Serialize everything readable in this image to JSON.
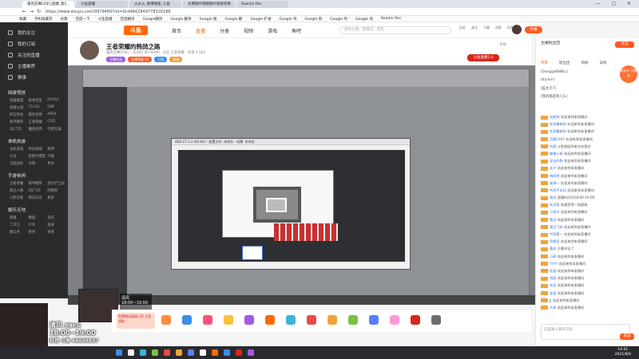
{
  "browser": {
    "tabs": [
      {
        "label": "蓬风恋赛CDEC直播_第5...",
        "active": true
      },
      {
        "label": "斗鱼直播",
        "active": false
      },
      {
        "label": "火炎火_微博搜索_斗鱼",
        "active": false
      },
      {
        "label": "文库图片网络图片搜索结果",
        "active": false
      },
      {
        "label": "Rwxdin Rec",
        "active": false
      }
    ],
    "window_controls": "— ▢ ✕",
    "url": "https://www.douyu.com/9979489?rid=0cd4662849778320188",
    "bookmarks": [
      "收藏",
      "手机收藏夹",
      "谷歌",
      "百度一下",
      "斗鱼直播",
      "百度翻译",
      "Google翻译",
      "Google 翻译",
      "Google 搜",
      "Google 翻",
      "Google 扩展",
      "Google 书",
      "Google 新",
      "Google 导",
      "Google 地",
      "Reader Rec"
    ]
  },
  "sidebar": {
    "top_items": [
      "我的关注",
      "我的订阅",
      "关注的直播",
      "主播推荐",
      "赛事"
    ],
    "sections": [
      {
        "title": "网游竞技",
        "items": [
          "英雄联盟",
          "绝地求生",
          "DOTA2",
          "穿越火线",
          "CS:GO",
          "DNF",
          "炉石传说",
          "我的世界",
          "APEX",
          "和平精英",
          "王者荣耀",
          "COD",
          "QQ飞车",
          "魔兽世界",
          "守望先锋"
        ]
      },
      {
        "title": "单机热游",
        "items": [
          "主机游戏",
          "怀旧游戏",
          "原神",
          "方舟",
          "荒野大镖客",
          "只狼",
          "全面战争",
          "文明",
          "更多"
        ]
      },
      {
        "title": "手游休闲",
        "items": [
          "王者荣耀",
          "和平精英",
          "金铲铲之战",
          "第五人格",
          "QQ飞车",
          "阴阳师",
          "火影忍者",
          "明日方舟",
          "更多"
        ]
      },
      {
        "title": "娱乐天地",
        "items": [
          "颜值",
          "舞蹈",
          "音乐",
          "二次元",
          "户外",
          "美食",
          "脱口秀",
          "星秀",
          "体育"
        ]
      }
    ]
  },
  "site_header": {
    "logo": "斗鱼",
    "nav": [
      "首页",
      "直播",
      "分类",
      "视频",
      "游戏",
      "鱼吧"
    ],
    "search_placeholder": "搜索主播、直播间、游戏",
    "icons": [
      "历史",
      "关注",
      "下载",
      "消息",
      "任务"
    ],
    "open_broadcast": "开播"
  },
  "streamer": {
    "title": "王者荣耀的韩鸽之路",
    "meta": "蓬风恋赛CDEC · 房间号 9979489 · 分区 王者荣耀 · 热度 4,562",
    "pills": [
      "主播任务",
      "主播等级 42",
      "订阅",
      "周星"
    ],
    "report": "举报",
    "badge": "斗鱼直播2.0"
  },
  "nested": {
    "inner_tab": "蓬风恋赛CDEC直播_第5...",
    "obs_title": "OBS 27.1.3 (64-bit) - 配置文件: 未命名 - 场景: 未命名"
  },
  "overlays": {
    "inner_clock_name": "清风",
    "inner_clock_time": "18:00~19:00",
    "outer_clock_name": "清风",
    "outer_label": "直播时间",
    "outer_time": "18:00~19:00",
    "outer_id": "抖音 斗鱼 66668857"
  },
  "gifts": {
    "promo": "免费赠送超级火箭 立即领取",
    "colors": [
      "#ff8c3b",
      "#3a8ee6",
      "#ff4f78",
      "#f6c23e",
      "#9f5be8",
      "#ff6a00",
      "#3ab6d8",
      "#e84a4a",
      "#f0a33b",
      "#7bc043",
      "#5a7dff",
      "#ff9ad5",
      "#d8261b",
      "#6c6c6c"
    ]
  },
  "rightpanel": {
    "top_title": "主播粉丝团",
    "follow": "关注",
    "rank_label": "贵宾",
    "tabs": [
      "贵宾",
      "粉丝团",
      "周榜",
      "日榜"
    ],
    "rows": [
      "[DonggeNNNiu]",
      "[Karkie]",
      "[猫主子7]",
      "[我的都是刺儿头]"
    ],
    "chat": [
      {
        "user": "泓斯林",
        "text": "欢迎来到本直播间"
      },
      {
        "user": "吃到最新的",
        "text": "欢迎来到本直播间"
      },
      {
        "user": "吃到最新的",
        "text": "欢迎来到本直播间"
      },
      {
        "user": "月晨1997",
        "text": "欢迎来到本直播间"
      },
      {
        "user": "何星",
        "text": "斗鱼鼓励你本次先提交"
      },
      {
        "user": "蜡笔小新",
        "text": "欢迎来到本直播间"
      },
      {
        "user": "宝宝的狗",
        "text": "欢迎来到本直播间"
      },
      {
        "user": "走开",
        "text": "欢迎来到本直播间"
      },
      {
        "user": "梅欣然",
        "text": "欢迎来到本直播间"
      },
      {
        "user": "星城一",
        "text": "欢迎来到本直播间"
      },
      {
        "user": "鸡鸡不说话",
        "text": "欢迎来到本直播间"
      },
      {
        "user": "清风",
        "text": "直播时间为18:00-19:00"
      },
      {
        "user": "吃点饭",
        "text": "恭喜获得一张超级"
      },
      {
        "user": "小家伙",
        "text": "欢迎来到本直播间"
      },
      {
        "user": "雪月",
        "text": "欢迎来到本直播间"
      },
      {
        "user": "落日飞车",
        "text": "欢迎来到本直播间"
      },
      {
        "user": "中国第一",
        "text": "欢迎来到本直播间"
      },
      {
        "user": "阿帕奇",
        "text": "欢迎来到本直播间"
      },
      {
        "user": "蓬风",
        "text": "主播辛苦了"
      },
      {
        "user": "小胖",
        "text": "欢迎来到本直播间"
      },
      {
        "user": "YYYY",
        "text": "欢迎来到本直播间"
      },
      {
        "user": "吃饭",
        "text": "欢迎来到本直播间"
      },
      {
        "user": "泡面",
        "text": "欢迎来到本直播间"
      },
      {
        "user": "毛毛",
        "text": "欢迎来到本直播间"
      },
      {
        "user": "星星",
        "text": "欢迎来到本直播间"
      },
      {
        "user": "JJ",
        "text": "欢迎来到本直播间"
      },
      {
        "user": "大佬",
        "text": "欢迎来到本直播间"
      }
    ],
    "input_placeholder": "这里输入聊天内容",
    "send": "发送",
    "promo_bubble": "粉丝节 开播礼"
  },
  "taskbar": {
    "time": "14:01",
    "date": "2021/8/8",
    "icon_colors": [
      "#3a8ee6",
      "#eeeeee",
      "#3ab6d8",
      "#7bc043",
      "#e84a4a",
      "#f0a33b",
      "#5a7dff",
      "#ffffff",
      "#ff6a00",
      "#3a8ee6",
      "#d8261b",
      "#9f5be8"
    ]
  }
}
